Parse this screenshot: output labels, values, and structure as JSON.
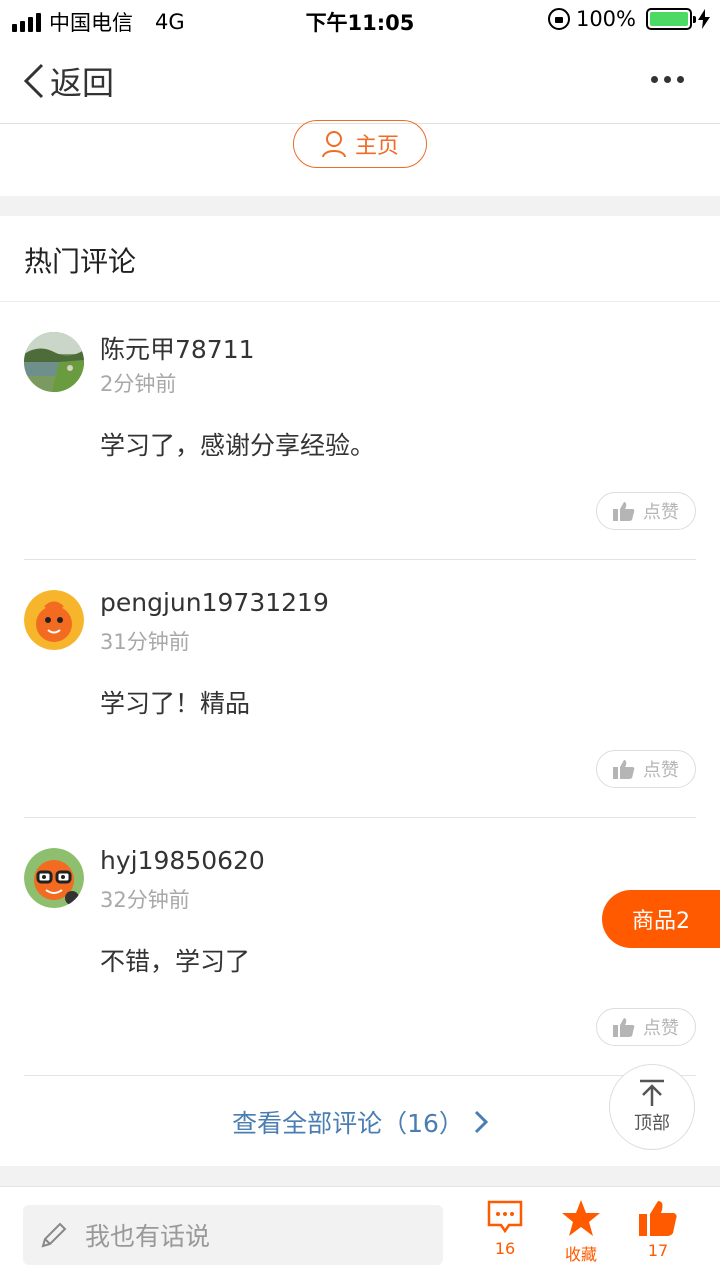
{
  "status_bar": {
    "carrier": "中国电信",
    "network": "4G",
    "time": "下午11:05",
    "battery": "100%"
  },
  "nav": {
    "back_label": "返回"
  },
  "profile": {
    "home_label": "主页"
  },
  "section": {
    "title": "热门评论"
  },
  "comments": [
    {
      "name": "陈元甲78711",
      "time": "2分钟前",
      "text": "学习了，感谢分享经验。",
      "like_label": "点赞"
    },
    {
      "name": "pengjun19731219",
      "time": "31分钟前",
      "text": "学习了！精品",
      "like_label": "点赞"
    },
    {
      "name": "hyj19850620",
      "time": "32分钟前",
      "text": "不错，学习了",
      "like_label": "点赞"
    }
  ],
  "view_all": {
    "label": "查看全部评论（16）"
  },
  "floating": {
    "goods_label": "商品2",
    "top_label": "顶部"
  },
  "bottom": {
    "input_placeholder": "我也有话说",
    "comment_count": "16",
    "favorite_label": "收藏",
    "like_count": "17"
  },
  "colors": {
    "accent": "#ff5a00",
    "link": "#4a7db2"
  }
}
